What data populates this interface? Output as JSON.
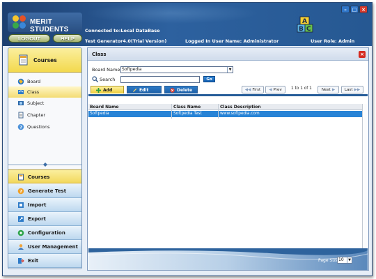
{
  "app": {
    "name": "MERIT STUDENTS",
    "logout_label": "LOGOUT",
    "help_label": "HELP",
    "connected_label": "Connected to:Local DataBase",
    "version_label": "Test Generator4.0(Trial Version)",
    "user_label": "Logged In User Name: Administrator",
    "role_label": "User Role: Admin"
  },
  "sidebar": {
    "header_label": "Courses",
    "items": [
      {
        "label": "Board",
        "icon": "board-icon"
      },
      {
        "label": "Class",
        "icon": "class-icon",
        "selected": true
      },
      {
        "label": "Subject",
        "icon": "subject-icon"
      },
      {
        "label": "Chapter",
        "icon": "chapter-icon"
      },
      {
        "label": "Questions",
        "icon": "questions-icon"
      }
    ],
    "nav": [
      {
        "label": "Courses",
        "style": "yellow",
        "icon": "courses-icon"
      },
      {
        "label": "Generate Test",
        "style": "blue",
        "icon": "generate-test-icon"
      },
      {
        "label": "Import",
        "style": "blue",
        "icon": "import-icon"
      },
      {
        "label": "Export",
        "style": "blue",
        "icon": "export-icon"
      },
      {
        "label": "Configuration",
        "style": "blue",
        "icon": "configuration-icon"
      },
      {
        "label": "User Management",
        "style": "blue",
        "icon": "user-management-icon"
      },
      {
        "label": "Exit",
        "style": "blue",
        "icon": "exit-icon"
      }
    ]
  },
  "content": {
    "title": "Class",
    "board_label": "Board Name:",
    "board_value": "Softpedia",
    "search_label": "Search",
    "search_value": "",
    "go_label": "Go",
    "tabs": {
      "add": "Add",
      "edit": "Edit",
      "delete": "Delete"
    },
    "pager": {
      "first": "First",
      "prev": "Prev",
      "status": "1 to 1 of 1",
      "next": "Next",
      "last": "Last"
    },
    "table": {
      "columns": [
        "Board Name",
        "Class Name",
        "Class Description"
      ],
      "rows": [
        [
          "Softpedia",
          "Softpedia Test",
          "www.softpedia.com"
        ]
      ]
    },
    "footer": {
      "page_size_label": "Page Size:",
      "page_size_value": "10"
    }
  },
  "colors": {
    "title_blue": "#2d619f",
    "accent_yellow": "#f3d94e",
    "row_selected": "#2783d6",
    "close_red": "#d52a1f"
  }
}
